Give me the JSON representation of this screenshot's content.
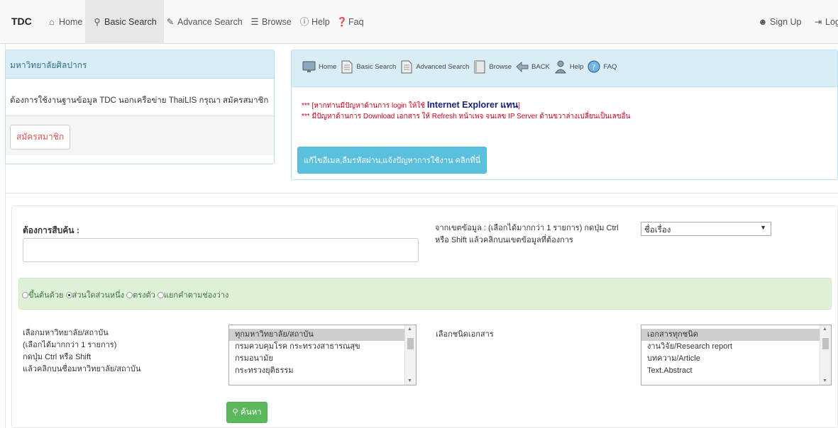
{
  "navbar": {
    "brand": "TDC",
    "items": [
      {
        "icon": "home-icon",
        "glyph": "⌂",
        "label": "Home"
      },
      {
        "icon": "search-icon",
        "glyph": "⚲",
        "label": "Basic Search",
        "active": true
      },
      {
        "icon": "edit-icon",
        "glyph": "✎",
        "label": "Advance Search"
      },
      {
        "icon": "list-icon",
        "glyph": "☰",
        "label": "Browse"
      },
      {
        "icon": "info-icon",
        "glyph": "ℹ",
        "label": "Help"
      },
      {
        "icon": "question-icon",
        "glyph": "?",
        "label": "Faq"
      }
    ],
    "right": [
      {
        "icon": "user-icon",
        "glyph": "👤",
        "label": "Sign Up"
      },
      {
        "icon": "login-icon",
        "glyph": "⇥",
        "label": "Logi"
      }
    ]
  },
  "left_panel": {
    "heading": "มหาวิทยาลัยศิลปากร",
    "body": "ต้องการใช้งานฐานข้อมูล TDC นอกเครือข่าย ThaiLIS กรุณา สมัครสมาชิก",
    "register_button": "สมัครสมาชิก"
  },
  "right_panel": {
    "menu": [
      {
        "icon": "monitor-icon",
        "label": "Home"
      },
      {
        "icon": "document-icon",
        "label": "Basic Search"
      },
      {
        "icon": "document-icon",
        "label": "Advanced Search"
      },
      {
        "icon": "book-icon",
        "label": "Browse"
      },
      {
        "icon": "back-arrow-icon",
        "label": "BACK"
      },
      {
        "icon": "person-icon",
        "label": "Help"
      },
      {
        "icon": "faq-icon",
        "label": "FAQ"
      }
    ],
    "notice_1_prefix": "*** [หากท่านมีปัญหาด้านการ login ให้ใช้",
    "notice_1_ie": "Internet Explorer แทน",
    "notice_1_suffix": "]",
    "notice_2": "*** มีปัญหาด้านการ Download เอกสาร ให้ Refresh หน้าเพจ จนเลข IP Server ด้านขวาล่างเปลี่ยนเป็นเลขอื่น",
    "fix_button": "แก้ไขอีเมล,ลืมรหัสผ่าน,แจ้งปัญหาการใช้งาน คลิกที่นี่"
  },
  "search": {
    "query_label": "ต้องการสืบค้น :",
    "query_value": "",
    "field_label": "จากเขตข้อมูล : (เลือกได้มากกว่า 1 รายการ) กดปุ่ม Ctrl หรือ Shift แล้วคลิกบนเขตข้อมูลที่ต้องการ",
    "field_select_value": "ชื่อเรื่อง",
    "match_options": [
      {
        "label": "ขึ้นต้นด้วย",
        "checked": false
      },
      {
        "label": "ส่วนใดส่วนหนึ่ง",
        "checked": true
      },
      {
        "label": "ตรงตัว",
        "checked": false
      },
      {
        "label": "แยกคำตามช่องว่าง",
        "checked": false
      }
    ],
    "university_label": [
      "เลือกมหาวิทยาลัย/สถาบัน",
      "(เลือกได้มากกว่า 1 รายการ)",
      "กดปุ่ม Ctrl หรือ Shift",
      "แล้วคลิกบนชื่อมหาวิทยาลัย/สถาบัน"
    ],
    "university_options": [
      {
        "label": "ทุกมหาวิทยาลัย/สถาบัน",
        "selected": true
      },
      {
        "label": "กรมควบคุมโรค กระทรวงสาธารณสุข",
        "selected": false
      },
      {
        "label": "กรมอนามัย",
        "selected": false
      },
      {
        "label": "กระทรวงยุติธรรม",
        "selected": false
      }
    ],
    "doctype_label": "เลือกชนิดเอกสาร",
    "doctype_options": [
      {
        "label": "เอกสารทุกชนิด",
        "selected": true
      },
      {
        "label": "งานวิจัย/Research report",
        "selected": false
      },
      {
        "label": "บทความ/Article",
        "selected": false
      },
      {
        "label": "Text.Abstract",
        "selected": false
      }
    ],
    "search_button": "ค้นหา"
  }
}
